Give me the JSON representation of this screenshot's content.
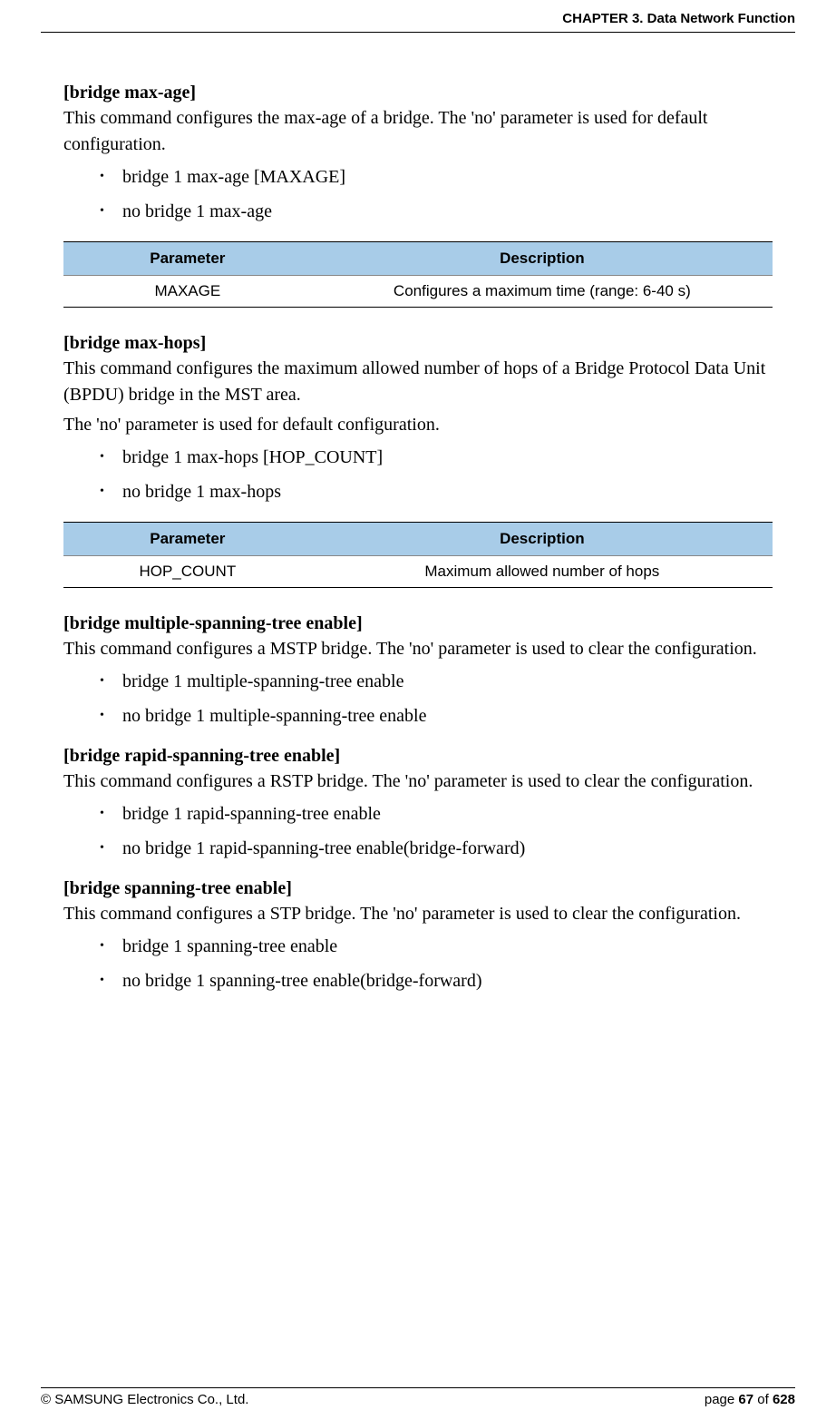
{
  "header": {
    "chapter": "CHAPTER 3. Data Network Function"
  },
  "sections": [
    {
      "title": "[bridge max-age]",
      "paragraphs": [
        "This command configures the max-age of a bridge. The 'no' parameter is used for default configuration."
      ],
      "commands": [
        "bridge 1 max-age [MAXAGE]",
        "no bridge 1 max-age"
      ],
      "table": {
        "headers": [
          "Parameter",
          "Description"
        ],
        "rows": [
          [
            "MAXAGE",
            "Configures a maximum time (range: 6-40 s)"
          ]
        ]
      }
    },
    {
      "title": "[bridge max-hops]",
      "paragraphs": [
        "This command configures the maximum allowed number of hops of a Bridge Protocol Data Unit (BPDU) bridge in the MST area.",
        "The 'no' parameter is used for default configuration."
      ],
      "commands": [
        "bridge 1 max-hops [HOP_COUNT]",
        "no bridge 1 max-hops"
      ],
      "table": {
        "headers": [
          "Parameter",
          "Description"
        ],
        "rows": [
          [
            "HOP_COUNT",
            "Maximum allowed number of hops"
          ]
        ]
      }
    },
    {
      "title": "[bridge multiple-spanning-tree enable]",
      "paragraphs": [
        "This command configures a MSTP bridge. The 'no' parameter is used to clear the configuration."
      ],
      "commands": [
        "bridge 1 multiple-spanning-tree enable",
        "no bridge 1 multiple-spanning-tree enable"
      ]
    },
    {
      "title": "[bridge rapid-spanning-tree enable]",
      "paragraphs": [
        "This command configures a RSTP bridge. The 'no' parameter is used to clear the configuration."
      ],
      "commands": [
        "bridge 1 rapid-spanning-tree enable",
        "no bridge 1 rapid-spanning-tree enable(bridge-forward)"
      ]
    },
    {
      "title": "[bridge spanning-tree enable]",
      "paragraphs": [
        "This command configures a STP bridge. The 'no' parameter is used to clear the configuration."
      ],
      "commands": [
        "bridge 1 spanning-tree enable",
        "no bridge 1 spanning-tree enable(bridge-forward)"
      ]
    }
  ],
  "footer": {
    "copyright": "© SAMSUNG Electronics Co., Ltd.",
    "page_prefix": "page ",
    "page_current": "67",
    "page_of": " of ",
    "page_total": "628"
  }
}
